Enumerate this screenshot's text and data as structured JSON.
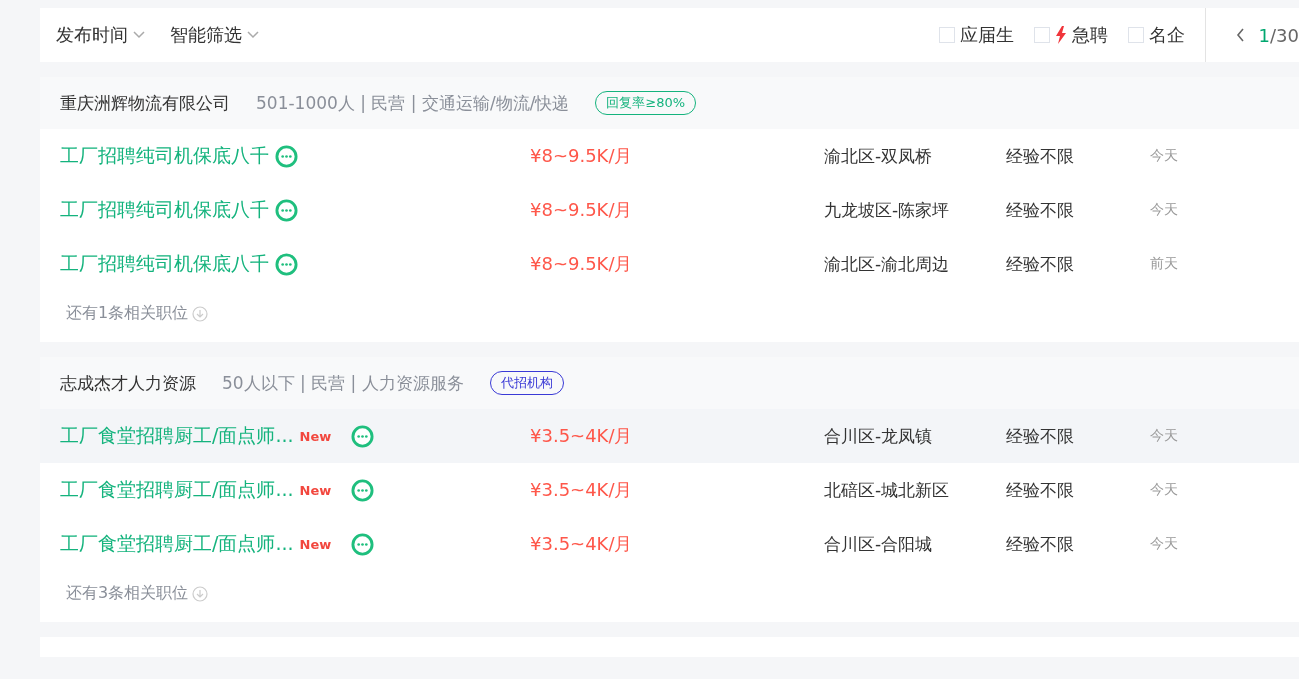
{
  "filter_bar": {
    "dropdowns": [
      {
        "label": "发布时间"
      },
      {
        "label": "智能筛选"
      }
    ],
    "checkboxes": [
      {
        "label": "应届生",
        "checked": false,
        "kind": "plain"
      },
      {
        "label": "急聘",
        "checked": false,
        "kind": "urgent"
      },
      {
        "label": "名企",
        "checked": false,
        "kind": "plain"
      }
    ],
    "pagination": {
      "current": "1",
      "total": "/30"
    }
  },
  "companies": [
    {
      "name": "重庆洲辉物流有限公司",
      "info": "501-1000人 | 民营 | 交通运输/物流/快递",
      "tag": {
        "label": "回复率≥80%",
        "kind": "reply-rate"
      },
      "jobs": [
        {
          "title": "工厂招聘纯司机保底八千",
          "salary": "¥8~9.5K/月",
          "location": "渝北区-双凤桥",
          "experience": "经验不限",
          "date": "今天",
          "highlighted": false
        },
        {
          "title": "工厂招聘纯司机保底八千",
          "salary": "¥8~9.5K/月",
          "location": "九龙坡区-陈家坪",
          "experience": "经验不限",
          "date": "今天",
          "highlighted": false
        },
        {
          "title": "工厂招聘纯司机保底八千",
          "salary": "¥8~9.5K/月",
          "location": "渝北区-渝北周边",
          "experience": "经验不限",
          "date": "前天",
          "highlighted": false
        }
      ],
      "more": "还有1条相关职位"
    },
    {
      "name": "志成杰才人力资源",
      "info": "50人以下 | 民营 | 人力资源服务",
      "tag": {
        "label": "代招机构",
        "kind": "agency"
      },
      "jobs": [
        {
          "title": "工厂食堂招聘厨工/面点师...",
          "new_label": "New",
          "salary": "¥3.5~4K/月",
          "location": "合川区-龙凤镇",
          "experience": "经验不限",
          "date": "今天",
          "highlighted": true
        },
        {
          "title": "工厂食堂招聘厨工/面点师...",
          "new_label": "New",
          "salary": "¥3.5~4K/月",
          "location": "北碚区-城北新区",
          "experience": "经验不限",
          "date": "今天",
          "highlighted": false
        },
        {
          "title": "工厂食堂招聘厨工/面点师...",
          "new_label": "New",
          "salary": "¥3.5~4K/月",
          "location": "合川区-合阳城",
          "experience": "经验不限",
          "date": "今天",
          "highlighted": false
        }
      ],
      "more": "还有3条相关职位"
    }
  ]
}
